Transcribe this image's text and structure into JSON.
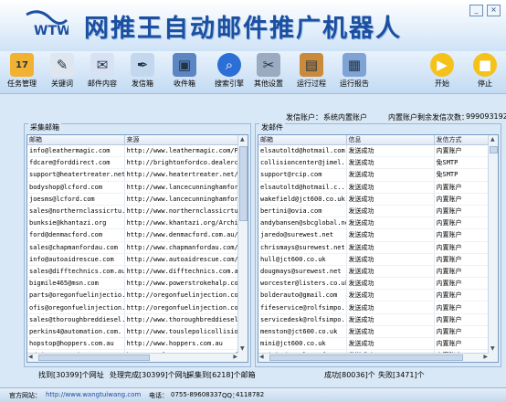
{
  "app": {
    "title": "网推王自动邮件推广机器人"
  },
  "window_buttons": {
    "minimize": "_",
    "close": "×"
  },
  "toolbar": {
    "items": [
      {
        "label": "任务管理",
        "icon": "calendar-icon",
        "color": "#f1b133"
      },
      {
        "label": "关键词",
        "icon": "notepad-icon",
        "color": "#e0e6ef"
      },
      {
        "label": "邮件内容",
        "icon": "envelope-icon",
        "color": "#d7e3f4"
      },
      {
        "label": "发信箱",
        "icon": "pen-icon",
        "color": "#c3d7ef"
      },
      {
        "label": "收件箱",
        "icon": "monitor-icon",
        "color": "#5b86c2"
      },
      {
        "label": "搜索引擎",
        "icon": "search-icon",
        "color": "#2b6fd6"
      },
      {
        "label": "其他设置",
        "icon": "tools-icon",
        "color": "#9aaac0"
      },
      {
        "label": "运行过程",
        "icon": "book-icon",
        "color": "#c98a3c"
      },
      {
        "label": "运行报告",
        "icon": "report-icon",
        "color": "#7fa3d4"
      },
      {
        "label": "开始",
        "icon": "play-icon",
        "color": "#f4c21b"
      },
      {
        "label": "停止",
        "icon": "stop-icon",
        "color": "#f4c21b"
      }
    ]
  },
  "info": {
    "sender_label": "发信账户：",
    "sender_value": "系统内置账户",
    "quota_label": "内置账户剩余发信次数：",
    "quota_value": "999093192"
  },
  "left_panel": {
    "title": "采集邮箱",
    "columns": [
      "邮箱",
      "来源"
    ],
    "rows": [
      [
        "info@leathermagic.com",
        "http://www.leathermagic.com/Fa"
      ],
      [
        "fdcare@forddirect.com",
        "http://brightonfordco.dealerco"
      ],
      [
        "support@heatertreater.net",
        "http://www.heatertreater.net/i"
      ],
      [
        "bodyshop@lcford.com",
        "http://www.lancecunninghamford."
      ],
      [
        "joesms@lcford.com",
        "http://www.lancecunninghamford."
      ],
      [
        "sales@northernclassicrtu.",
        "http://www.northernclassicrtu."
      ],
      [
        "bunksie@khantazi.org",
        "http://www.khantazi.org/Archiv."
      ],
      [
        "ford@denmacford.com",
        "http://www.denmacford.com.au//"
      ],
      [
        "sales@chapmanfordau.com",
        "http://www.chapmanfordau.com/c."
      ],
      [
        "info@autoaidrescue.com",
        "http://www.autoaidrescue.com/c."
      ],
      [
        "sales@difftechnics.com.au",
        "http://www.difftechnics.com.au"
      ],
      [
        "bigmile465@msn.com",
        "http://www.powerstrokehalp.com/"
      ],
      [
        "parts@oregonfuelinjectio.",
        "http://oregonfuelinjection.com"
      ],
      [
        "ofis@oregonfuelinjection.",
        "http://oregonfuelinjection.com"
      ],
      [
        "sales@thoroughbreddiesel.",
        "http://www.thoroughbreddiesel."
      ],
      [
        "perkins4@automation.com.",
        "http://www.touslepolicollision."
      ],
      [
        "hopstop@hoppers.com.au",
        "http://www.hoppers.com.au"
      ],
      [
        "admin@yesterdaystractors.",
        "http://ytforums.ytmag.com/ttfo"
      ]
    ],
    "summary": {
      "found": "找到[30399]个网址",
      "processed": "处理完成[30399]个网址",
      "collected": "采集到[6218]个邮箱"
    }
  },
  "right_panel": {
    "title": "发邮件",
    "columns": [
      "邮箱",
      "信息",
      "发信方式"
    ],
    "rows": [
      [
        "elsautoltd@hotmail.com",
        "发送成功",
        "内置账户"
      ],
      [
        "collisioncenter@jimel...",
        "发送成功",
        "免SMTP"
      ],
      [
        "support@rcip.com",
        "发送成功",
        "免SMTP"
      ],
      [
        "elsautoltd@hotmail.c...",
        "发送成功",
        "内置账户"
      ],
      [
        "wakefield@jct600.co.uk",
        "发送成功",
        "内置账户"
      ],
      [
        "bertini@ovia.com",
        "发送成功",
        "内置账户"
      ],
      [
        "andybansen@sbcglobal.net",
        "发送成功",
        "内置账户"
      ],
      [
        "jaredo@surewest.net",
        "发送成功",
        "内置账户"
      ],
      [
        "chrismays@surewest.net",
        "发送成功",
        "内置账户"
      ],
      [
        "hull@jct600.co.uk",
        "发送成功",
        "内置账户"
      ],
      [
        "dougmays@surewest.net",
        "发送成功",
        "内置账户"
      ],
      [
        "worcester@listers.co.uk",
        "发送成功",
        "内置账户"
      ],
      [
        "bolderauto@gmail.com",
        "发送成功",
        "内置账户"
      ],
      [
        "fifeservice@rolfsimpo...",
        "发送成功",
        "内置账户"
      ],
      [
        "servicedesk@rolfsimpo...",
        "发送成功",
        "内置账户"
      ],
      [
        "menston@jct600.co.uk",
        "发送成功",
        "内置账户"
      ],
      [
        "mini@jct600.co.uk",
        "发送成功",
        "内置账户"
      ],
      [
        "erishodes@platsoft.com",
        "发送成功",
        "内置账户"
      ],
      [
        "enquiries@swiftmotore...",
        "发送成功",
        "内置账户"
      ]
    ],
    "summary": {
      "success": "成功[80036]个",
      "failed": "失败[3471]个"
    }
  },
  "statusbar": {
    "site_label": "官方网站：",
    "site_value": "http://www.wangtuiwang.com",
    "phone_label": "电话：",
    "phone_value": "0755-89608337",
    "qq_label": "QQ：",
    "qq_value": "4118782"
  }
}
